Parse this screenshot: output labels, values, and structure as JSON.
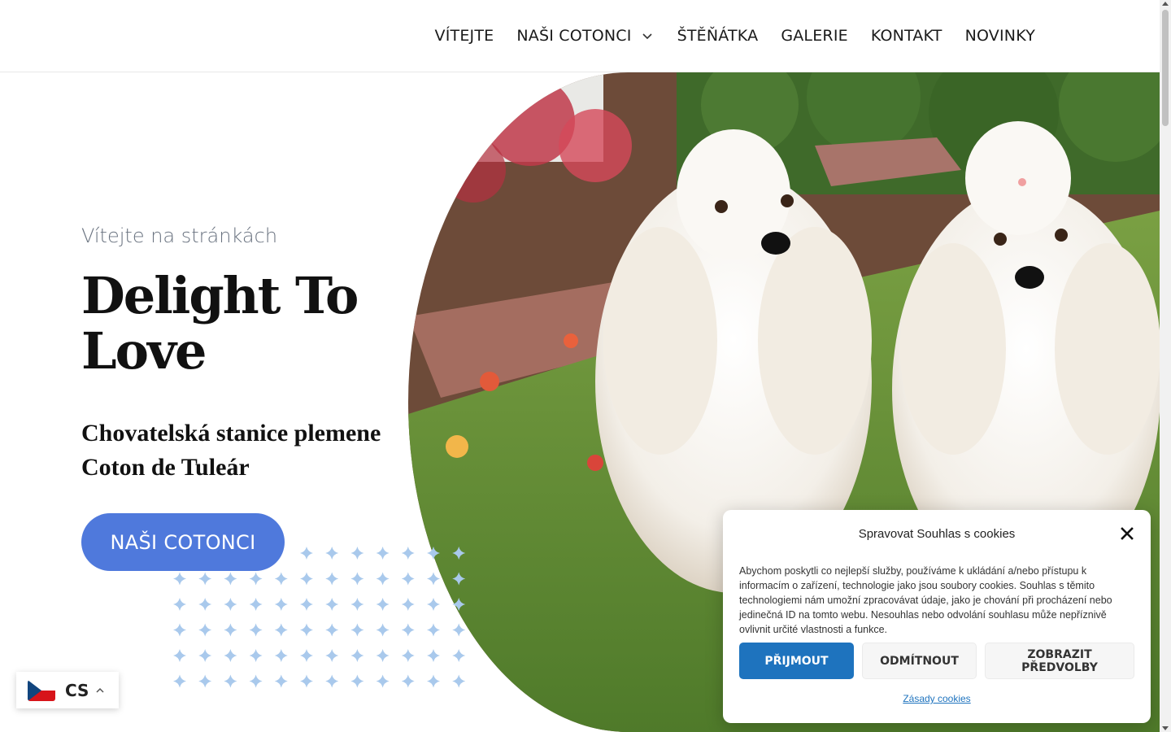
{
  "nav": {
    "items": [
      "VÍTEJTE",
      "NAŠI COTONCI",
      "ŠTĚŇÁTKA",
      "GALERIE",
      "KONTAKT",
      "NOVINKY"
    ]
  },
  "hero": {
    "subtitle": "Vítejte na stránkách",
    "title": "Delight To Love",
    "tagline": "Chovatelská stanice plemene Coton de Tuleár",
    "cta_label": "NAŠI COTONCI"
  },
  "language": {
    "code": "CS"
  },
  "cookie": {
    "title": "Spravovat Souhlas s cookies",
    "text": "Abychom poskytli co nejlepší služby, používáme k ukládání a/nebo přístupu k informacím o zařízení, technologie jako jsou soubory cookies. Souhlas s těmito technologiemi nám umožní zpracovávat údaje, jako je chování při procházení nebo jedinečná ID na tomto webu. Nesouhlas nebo odvolání souhlasu může nepříznivě ovlivnit určité vlastnosti a funkce.",
    "accept": "PŘIJMOUT",
    "deny": "ODMÍTNOUT",
    "preferences": "ZOBRAZIT PŘEDVOLBY",
    "policy_link": "Zásady cookies"
  },
  "colors": {
    "cta": "#4f79dc",
    "accept": "#1e73be",
    "dots": "#a9c9ec"
  }
}
